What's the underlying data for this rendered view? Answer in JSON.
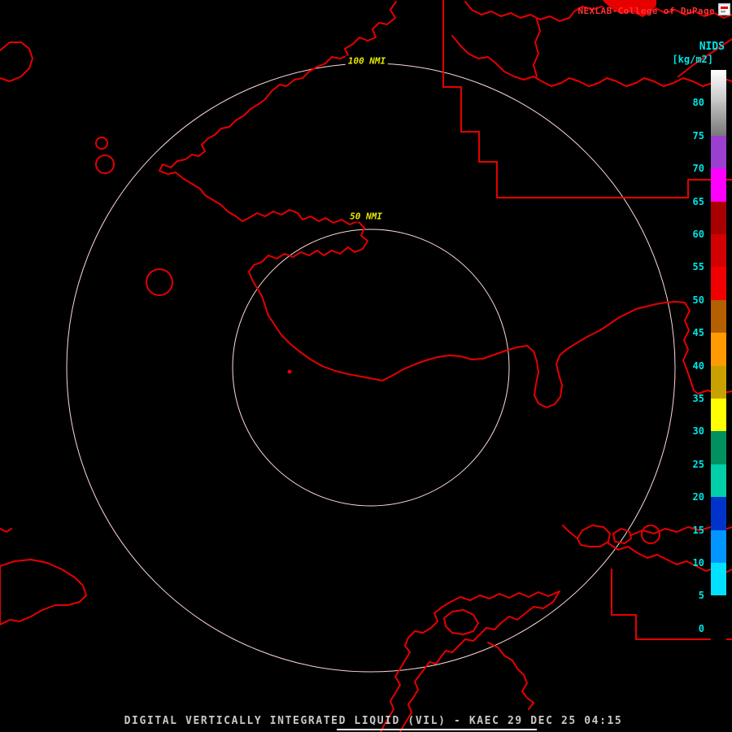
{
  "header": {
    "brand": "NEXLAB-College of DuPage"
  },
  "legend": {
    "title": "NIDS",
    "units": "[kg/m2]",
    "ticks": [
      "80",
      "75",
      "70",
      "65",
      "60",
      "55",
      "50",
      "45",
      "40",
      "35",
      "30",
      "25",
      "20",
      "15",
      "10",
      "5",
      "0"
    ],
    "segments": [
      {
        "range": "80-85",
        "colors": [
          "#FFFFFF",
          "#C4C4C4"
        ]
      },
      {
        "range": "75-80",
        "colors": [
          "#C0C0C0",
          "#787878"
        ]
      },
      {
        "range": "70-75",
        "color": "#9B3FD1"
      },
      {
        "range": "65-70",
        "color": "#FF00FF"
      },
      {
        "range": "60-65",
        "color": "#A80000"
      },
      {
        "range": "55-60",
        "color": "#D20000"
      },
      {
        "range": "50-55",
        "color": "#F00000"
      },
      {
        "range": "45-50",
        "color": "#B45F00"
      },
      {
        "range": "40-45",
        "color": "#FF9B00"
      },
      {
        "range": "35-40",
        "color": "#C8A000"
      },
      {
        "range": "30-35",
        "color": "#FFFF00"
      },
      {
        "range": "25-30",
        "color": "#00915E"
      },
      {
        "range": "20-25",
        "color": "#00CFA8"
      },
      {
        "range": "15-20",
        "color": "#0033CC"
      },
      {
        "range": "10-15",
        "color": "#0095FF"
      },
      {
        "range": "5-10",
        "color": "#00E1FF"
      },
      {
        "range": "0-5",
        "color": "#000000"
      }
    ]
  },
  "rings": {
    "outer_label": "100 NMI",
    "inner_label": "50 NMI"
  },
  "footer": {
    "text": "DIGITAL VERTICALLY INTEGRATED LIQUID (VIL) - KAEC 29 DEC 25 04:15"
  },
  "colors": {
    "background": "#000000",
    "map_outline": "#E60000",
    "range_ring": "#FFD9D9",
    "ring_label": "#E8E800",
    "brand_text": "#FF3232",
    "legend_text": "#00E6E6",
    "footer_text": "#C8C8C8",
    "underline": "#FFFFFF"
  }
}
